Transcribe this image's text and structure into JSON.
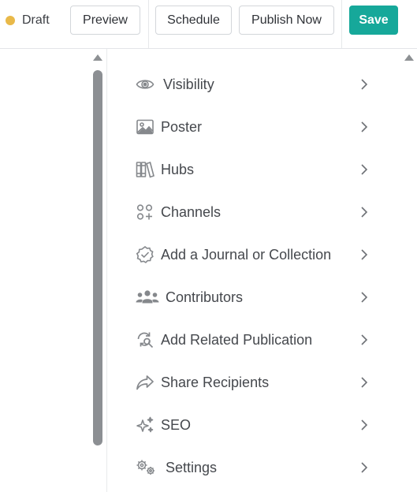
{
  "toolbar": {
    "status": "Draft",
    "preview_label": "Preview",
    "schedule_label": "Schedule",
    "publish_label": "Publish Now",
    "save_label": "Save"
  },
  "colors": {
    "status_dot": "#e9b949",
    "save_button": "#16a89a",
    "scrollbar": "#8c8f93"
  },
  "menu": {
    "items": [
      {
        "label": "Visibility",
        "icon": "eye-icon"
      },
      {
        "label": "Poster",
        "icon": "image-icon"
      },
      {
        "label": "Hubs",
        "icon": "books-icon"
      },
      {
        "label": "Channels",
        "icon": "channels-icon"
      },
      {
        "label": "Add a Journal or Collection",
        "icon": "badge-check-icon"
      },
      {
        "label": "Contributors",
        "icon": "users-icon"
      },
      {
        "label": "Add Related Publication",
        "icon": "related-icon"
      },
      {
        "label": "Share Recipients",
        "icon": "share-icon"
      },
      {
        "label": "SEO",
        "icon": "sparkles-icon"
      },
      {
        "label": "Settings",
        "icon": "gears-icon"
      }
    ]
  }
}
